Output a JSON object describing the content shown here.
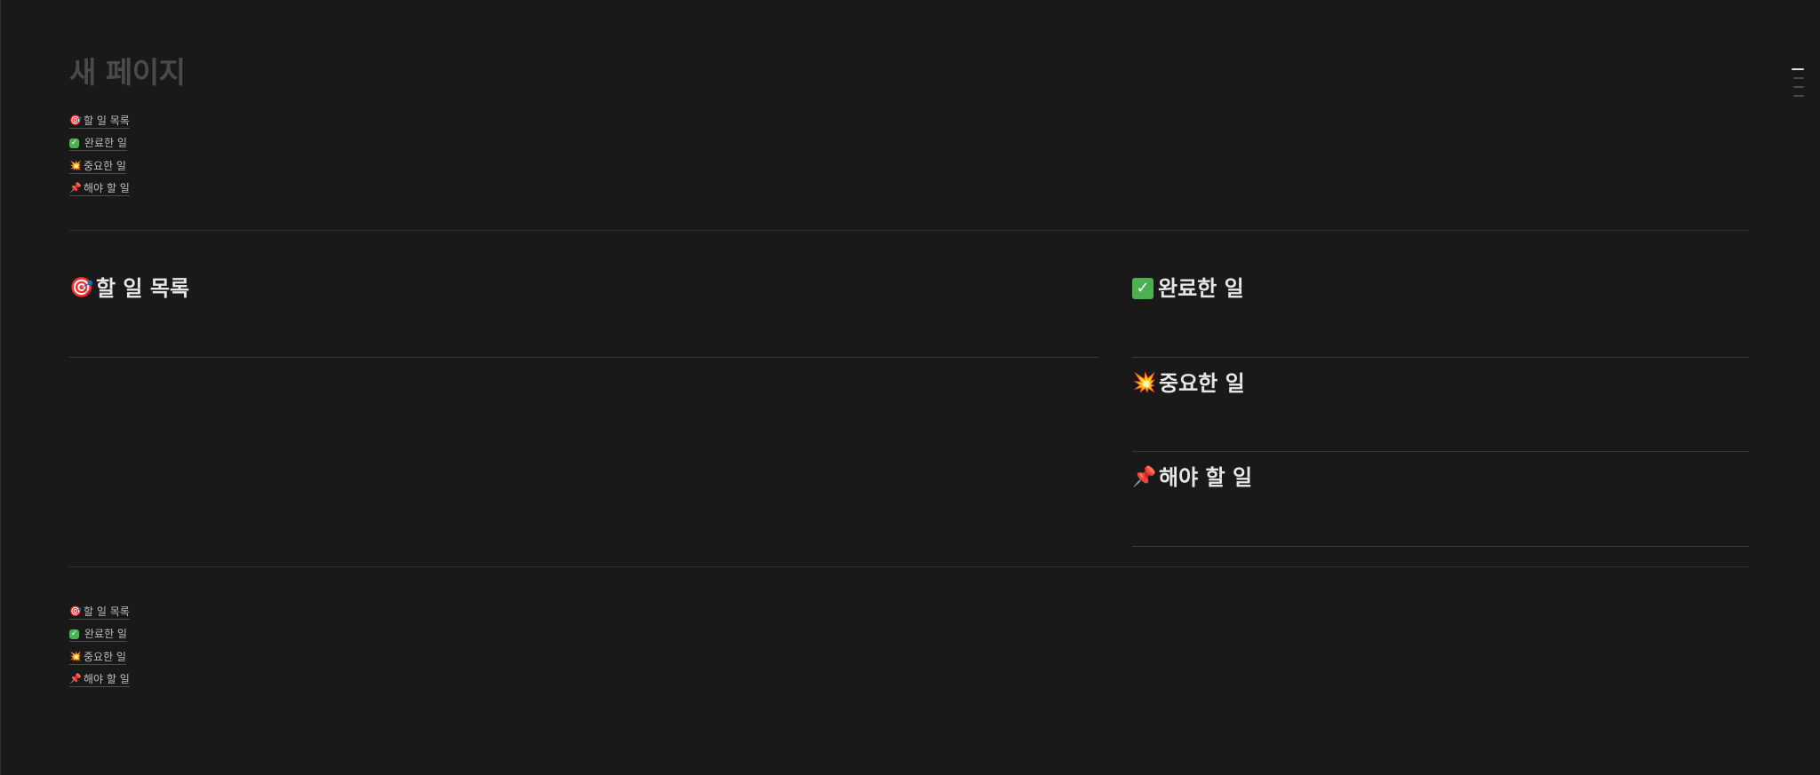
{
  "page": {
    "title": "새 페이지"
  },
  "toc_top": [
    {
      "icon": "direct-hit-target-icon",
      "emoji": "🎯",
      "label": "할 일 목록"
    },
    {
      "icon": "check-mark-button-icon",
      "emoji": "✓",
      "label": "완료한 일"
    },
    {
      "icon": "collision-icon",
      "emoji": "💥",
      "label": "중요한 일"
    },
    {
      "icon": "pushpin-icon",
      "emoji": "📌",
      "label": "해야 할 일"
    }
  ],
  "toc_bottom": [
    {
      "icon": "direct-hit-target-icon",
      "emoji": "🎯",
      "label": "할 일 목록"
    },
    {
      "icon": "check-mark-button-icon",
      "emoji": "✓",
      "label": "완료한 일"
    },
    {
      "icon": "collision-icon",
      "emoji": "💥",
      "label": "중요한 일"
    },
    {
      "icon": "pushpin-icon",
      "emoji": "📌",
      "label": "해야 할 일"
    }
  ],
  "columns": {
    "left": [
      {
        "icon": "direct-hit-target-icon",
        "emoji": "🎯",
        "heading": "할 일 목록"
      }
    ],
    "right": [
      {
        "icon": "check-mark-button-icon",
        "emoji": "✓",
        "heading": "완료한 일"
      },
      {
        "icon": "collision-icon",
        "emoji": "💥",
        "heading": "중요한 일"
      },
      {
        "icon": "pushpin-icon",
        "emoji": "📌",
        "heading": "해야 할 일"
      }
    ]
  },
  "colors": {
    "background": "#191919",
    "title_placeholder": "#4a4a4a",
    "heading": "#e6e6e6",
    "divider": "#2f2f2f",
    "check_green": "#4caf50"
  }
}
